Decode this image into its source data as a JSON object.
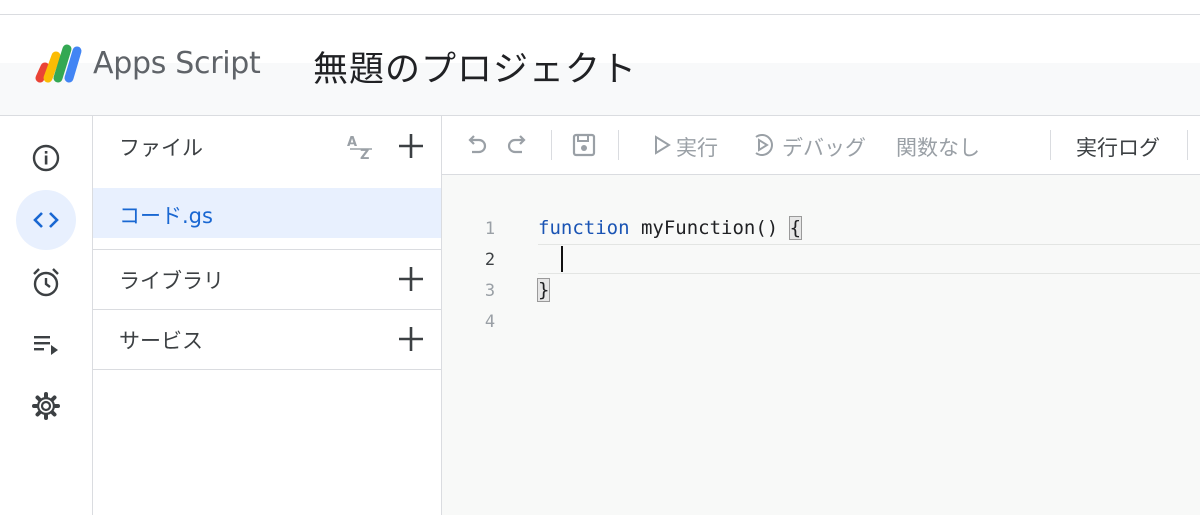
{
  "header": {
    "app_name": "Apps Script",
    "project_title": "無題のプロジェクト"
  },
  "rail": {
    "items": [
      {
        "icon": "info-icon",
        "active": false
      },
      {
        "icon": "code-icon",
        "active": true
      },
      {
        "icon": "alarm-clock-icon",
        "active": false
      },
      {
        "icon": "executions-icon",
        "active": false
      },
      {
        "icon": "gear-icon",
        "active": false
      }
    ]
  },
  "files_panel": {
    "title": "ファイル",
    "files": [
      {
        "name": "コード.gs",
        "selected": true
      }
    ],
    "libraries_label": "ライブラリ",
    "services_label": "サービス"
  },
  "toolbar": {
    "run_label": "実行",
    "debug_label": "デバッグ",
    "function_select": "関数なし",
    "log_label": "実行ログ"
  },
  "editor": {
    "lines": [
      {
        "number": "1",
        "keyword": "function",
        "text": " myFunction() ",
        "brace": "{"
      },
      {
        "number": "2",
        "text": ""
      },
      {
        "number": "3",
        "brace": "}"
      },
      {
        "number": "4",
        "text": ""
      }
    ]
  },
  "colors": {
    "accent": "#1967d2",
    "selected_bg": "#e8f0fe",
    "keyword": "#1a54b4",
    "editor_bg": "#f8f9f8"
  }
}
